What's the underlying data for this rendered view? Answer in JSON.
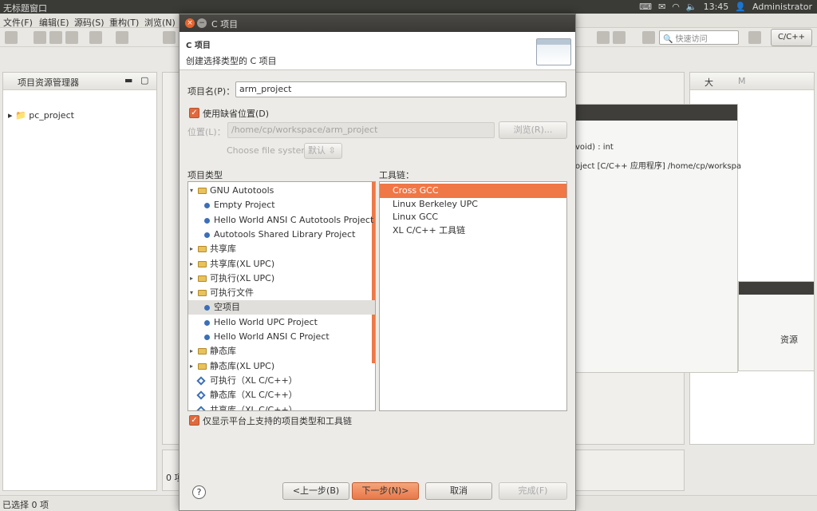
{
  "topbar": {
    "title": "无标题窗口",
    "time": "13:45",
    "user": "Administrator"
  },
  "menu": [
    "文件(F)",
    "编辑(E)",
    "源码(S)",
    "重构(T)",
    "浏览(N)"
  ],
  "toolbar_right": {
    "quick_access": "快速访问",
    "perspective": "C/C++"
  },
  "left_panel": {
    "title": "项目资源管理器",
    "tree": [
      "pc_project"
    ]
  },
  "status": {
    "text": "已选择 0 项"
  },
  "background": {
    "outline_title": "大",
    "outline_tab": "M",
    "void_text": "void) : int",
    "console_text": "oject [C/C++ 应用程序] /home/cp/workspa",
    "bottom_zero": "0 项",
    "resources_col": "资源"
  },
  "dialog": {
    "window_title": "C 项目",
    "header": "C 项目",
    "description": "创建选择类型的 C 项目",
    "project_name_label": "项目名(P)：",
    "project_name_value": "arm_project",
    "use_default_label": "使用缺省位置(D)",
    "use_default_checked": true,
    "location_label": "位置(L)：",
    "location_value": "/home/cp/workspace/arm_project",
    "browse_label": "浏览(R)...",
    "filesystem_label": "Choose file system:",
    "filesystem_value": "默认",
    "project_type_label": "项目类型",
    "toolchain_label": "工具链：",
    "project_types": [
      {
        "label": "GNU Autotools",
        "kind": "folder",
        "expanded": true,
        "level": 0
      },
      {
        "label": "Empty Project",
        "kind": "item",
        "level": 1
      },
      {
        "label": "Hello World ANSI C Autotools Project",
        "kind": "item",
        "level": 1
      },
      {
        "label": "Autotools Shared Library Project",
        "kind": "item",
        "level": 1
      },
      {
        "label": "共享库",
        "kind": "folder",
        "expanded": false,
        "level": 0
      },
      {
        "label": "共享库(XL UPC)",
        "kind": "folder",
        "expanded": false,
        "level": 0
      },
      {
        "label": "可执行(XL UPC)",
        "kind": "folder",
        "expanded": false,
        "level": 0
      },
      {
        "label": "可执行文件",
        "kind": "folder",
        "expanded": true,
        "level": 0
      },
      {
        "label": "空项目",
        "kind": "item",
        "level": 1,
        "selected": true
      },
      {
        "label": "Hello World UPC Project",
        "kind": "item",
        "level": 1
      },
      {
        "label": "Hello World ANSI C Project",
        "kind": "item",
        "level": 1
      },
      {
        "label": "静态库",
        "kind": "folder",
        "expanded": false,
        "level": 0
      },
      {
        "label": "静态库(XL UPC)",
        "kind": "folder",
        "expanded": false,
        "level": 0
      },
      {
        "label": "可执行（XL C/C++）",
        "kind": "diamond",
        "level": 0
      },
      {
        "label": "静态库（XL C/C++）",
        "kind": "diamond",
        "level": 0
      },
      {
        "label": "共享库（XL C/C++）",
        "kind": "diamond",
        "level": 0
      }
    ],
    "toolchains": [
      {
        "label": "Cross GCC",
        "selected": true
      },
      {
        "label": "Linux Berkeley UPC"
      },
      {
        "label": "Linux GCC"
      },
      {
        "label": "XL C/C++ 工具链"
      }
    ],
    "show_supported_label": "仅显示平台上支持的项目类型和工具链",
    "show_supported_checked": true,
    "buttons": {
      "back": "<上一步(B)",
      "next": "下一步(N)>",
      "cancel": "取消",
      "finish": "完成(F)"
    },
    "help": "?"
  },
  "colors": {
    "accent": "#f07746",
    "titlebar": "#3c3b37"
  }
}
